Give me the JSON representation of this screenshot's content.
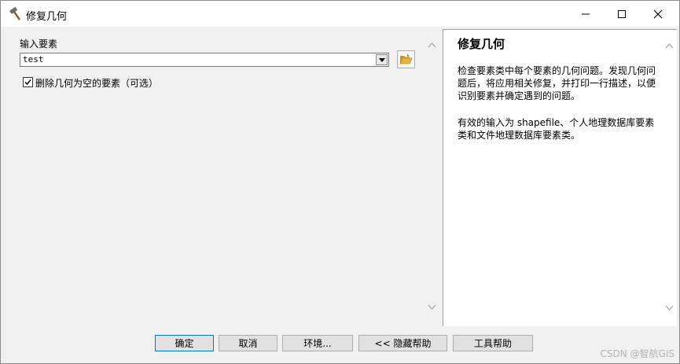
{
  "window": {
    "title": "修复几何",
    "title_icon": "hammer-icon",
    "controls": {
      "minimize_icon": "minimize-icon",
      "maximize_icon": "maximize-icon",
      "close_icon": "close-icon"
    }
  },
  "form": {
    "input_label": "输入要素",
    "input_value": "test",
    "browse_icon": "open-folder-icon",
    "delete_null_checkbox": {
      "label": "删除几何为空的要素（可选）",
      "checked": true
    }
  },
  "help": {
    "title": "修复几何",
    "paragraph1": "检查要素类中每个要素的几何问题。发现几何问题后，将应用相关修复，并打印一行描述，以便识别要素并确定遇到的问题。",
    "paragraph2": "有效的输入为 shapefile、个人地理数据库要素类和文件地理数据库要素类。"
  },
  "buttons": {
    "ok": "确定",
    "cancel": "取消",
    "environments": "环境...",
    "hide_help": "<< 隐藏帮助",
    "tool_help": "工具帮助"
  },
  "watermark": "CSDN @智航GIS",
  "colors": {
    "dialog_bg": "#f0f0f0",
    "help_bg": "#ffffff",
    "default_button_border": "#0078d7",
    "folder_icon": "#e8b440"
  }
}
